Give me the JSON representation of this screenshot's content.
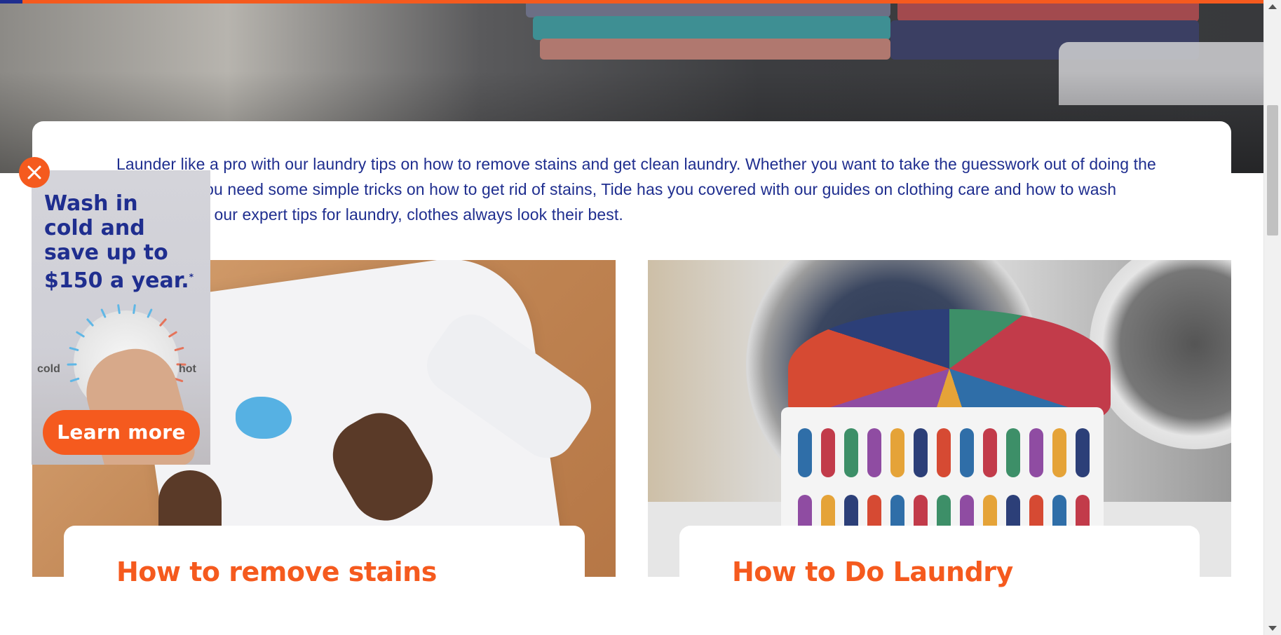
{
  "brand": {
    "accent": "#f55a1e",
    "navy": "#1f2e8f"
  },
  "intro": {
    "text": "Launder like a pro with our laundry tips on how to remove stains and get clean laundry. Whether you want to take the guesswork out of doing the laundry, or you need some simple tricks on how to get rid of stains, Tide has you covered with our guides on clothing care and how to wash clothes. With our expert tips for laundry, clothes always look their best."
  },
  "cards": [
    {
      "title": "How to remove stains",
      "image": "shirt-with-stain-image"
    },
    {
      "title": "How to Do Laundry",
      "image": "laundry-basket-image"
    }
  ],
  "ad": {
    "headline_lines": [
      "Wash in",
      "cold and",
      "save up to",
      "$150 a year."
    ],
    "footnote_mark": "*",
    "dial_left_label": "cold",
    "dial_right_label": "hot",
    "cta": "Learn more",
    "close_icon": "close-icon"
  }
}
